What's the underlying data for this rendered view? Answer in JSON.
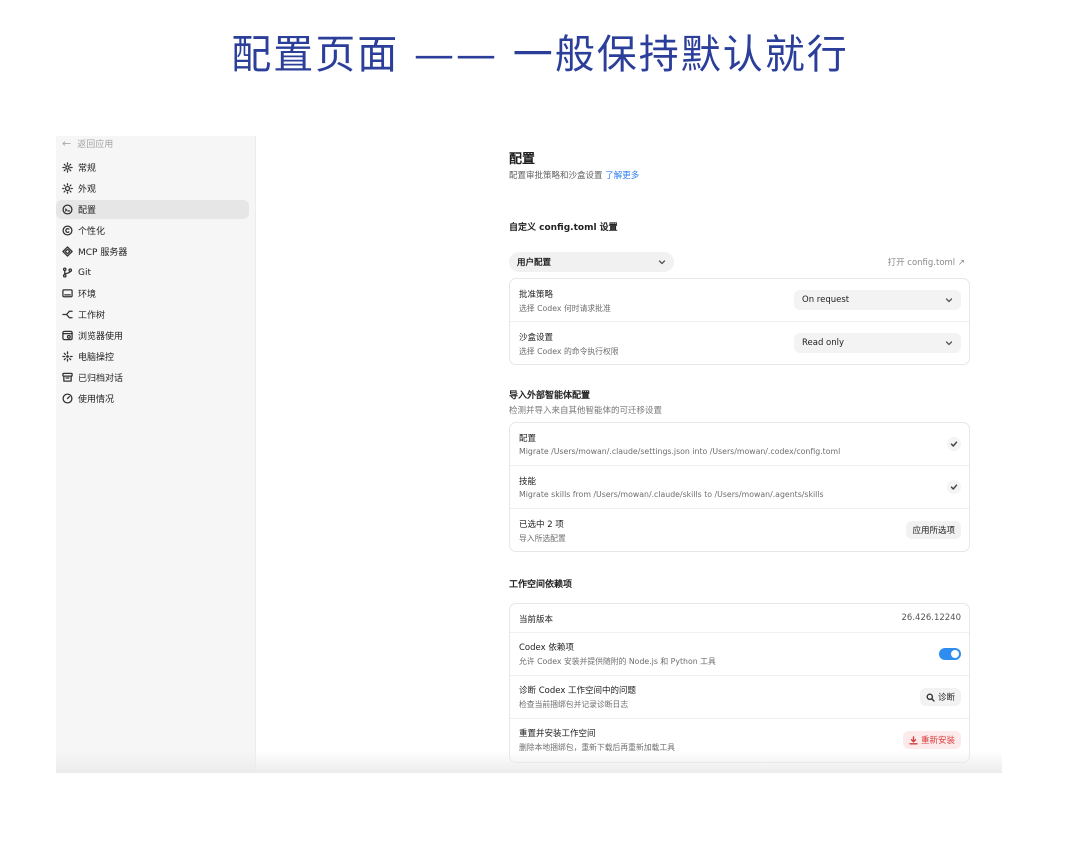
{
  "slide_title": "配置页面 —— 一般保持默认就行",
  "sidebar": {
    "back_label": "返回应用",
    "items": [
      {
        "label": "常规",
        "icon": "gear-icon",
        "active": false
      },
      {
        "label": "外观",
        "icon": "sun-icon",
        "active": false
      },
      {
        "label": "配置",
        "icon": "config-icon",
        "active": true
      },
      {
        "label": "个性化",
        "icon": "personalize-icon",
        "active": false
      },
      {
        "label": "MCP 服务器",
        "icon": "mcp-icon",
        "active": false
      },
      {
        "label": "Git",
        "icon": "git-branch-icon",
        "active": false
      },
      {
        "label": "环境",
        "icon": "monitor-icon",
        "active": false
      },
      {
        "label": "工作树",
        "icon": "worktree-icon",
        "active": false
      },
      {
        "label": "浏览器使用",
        "icon": "browser-icon",
        "active": false
      },
      {
        "label": "电脑操控",
        "icon": "sparkle-icon",
        "active": false
      },
      {
        "label": "已归档对话",
        "icon": "archive-icon",
        "active": false
      },
      {
        "label": "使用情况",
        "icon": "gauge-icon",
        "active": false
      }
    ]
  },
  "page": {
    "title": "配置",
    "subtitle": "配置审批策略和沙盒设置",
    "learn_more": "了解更多"
  },
  "custom_config": {
    "title": "自定义 config.toml 设置",
    "selected_profile": "用户配置",
    "open_link": "打开 config.toml ↗",
    "rows": [
      {
        "label": "批准策略",
        "desc": "选择 Codex 何时请求批准",
        "value": "On request"
      },
      {
        "label": "沙盒设置",
        "desc": "选择 Codex 的命令执行权限",
        "value": "Read only"
      }
    ]
  },
  "import": {
    "title": "导入外部智能体配置",
    "subtitle": "检测并导入来自其他智能体的可迁移设置",
    "items": [
      {
        "label": "配置",
        "desc": "Migrate /Users/mowan/.claude/settings.json into /Users/mowan/.codex/config.toml",
        "checked": true
      },
      {
        "label": "技能",
        "desc": "Migrate skills from /Users/mowan/.claude/skills to /Users/mowan/.agents/skills",
        "checked": true
      }
    ],
    "selected_label": "已选中 2 项",
    "selected_desc": "导入所选配置",
    "apply_button": "应用所选项"
  },
  "workspace": {
    "title": "工作空间依赖项",
    "version_label": "当前版本",
    "version_value": "26.426.12240",
    "deps_label": "Codex 依赖项",
    "deps_desc": "允许 Codex 安装并提供随附的 Node.js 和 Python 工具",
    "deps_enabled": true,
    "diagnose_label": "诊断 Codex 工作空间中的问题",
    "diagnose_desc": "检查当前捆绑包并记录诊断日志",
    "diagnose_button": "诊断",
    "reset_label": "重置并安装工作空间",
    "reset_desc": "删除本地捆绑包，重新下载后再重新加载工具",
    "reset_button": "重新安装"
  },
  "colors": {
    "slide_title": "#2b3f9a",
    "link": "#2f7cf6",
    "toggle_on": "#2f8cf0",
    "danger": "#d83b3b"
  }
}
